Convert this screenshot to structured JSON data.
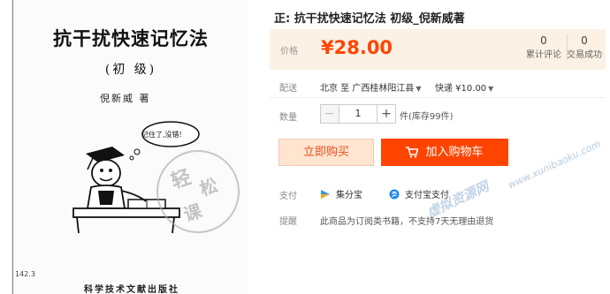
{
  "cover": {
    "title": "抗干扰快速记忆法",
    "level": "(初 级)",
    "author": "倪新威 著",
    "bubble": "记住了,没错!",
    "page_no": "142.3",
    "publisher": "科学技术文献出版社"
  },
  "product": {
    "title": "正: 抗干扰快速记忆法 初级_倪新威著",
    "price_label": "价格",
    "price": "¥28.00",
    "stats": [
      {
        "value": "0",
        "label": "累计评论"
      },
      {
        "value": "0",
        "label": "交易成功"
      }
    ]
  },
  "delivery": {
    "label": "配送",
    "route": "北京 至 广西桂林阳江县",
    "courier": "快递 ¥10.00"
  },
  "quantity": {
    "label": "数量",
    "value": "1",
    "stock": "件(库存99件)",
    "minus": "−",
    "plus": "+"
  },
  "actions": {
    "buy_now": "立即购买",
    "add_to_cart": "加入购物车"
  },
  "payment": {
    "label": "支付",
    "options": [
      "集分宝",
      "支付宝支付"
    ]
  },
  "reminder": {
    "label": "提醒",
    "text": "此商品为订阅类书籍，不支持7天无理由退货"
  },
  "watermarks": {
    "url": "www.xunibaoku.com",
    "cn": "虚拟资源网"
  },
  "stamp": {
    "text": [
      "轻",
      "松",
      "课"
    ]
  },
  "colors": {
    "accent": "#ff4400",
    "price_bg": "#fbf1e4",
    "buy_now_bg": "#ffe4d0"
  }
}
